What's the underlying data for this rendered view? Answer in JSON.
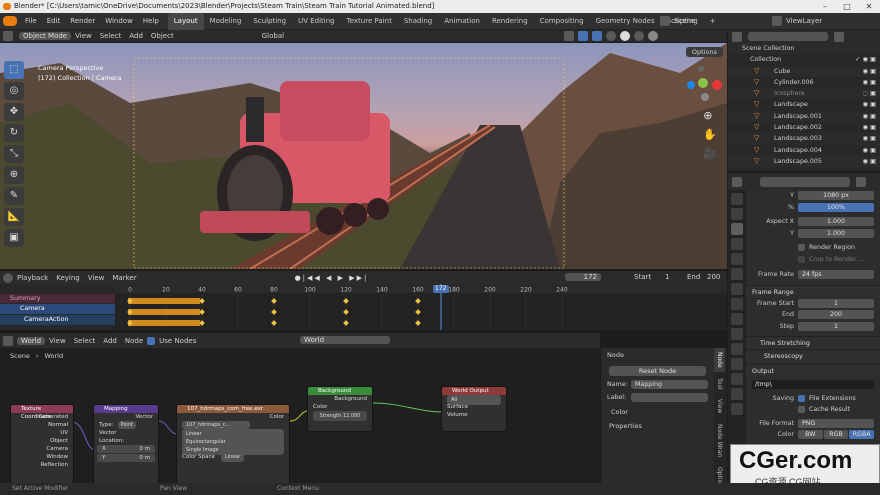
{
  "title_bar": {
    "title": "Blender* [C:\\Users\\tamic\\OneDrive\\Documents\\2023\\Blender\\Projects\\Steam Train\\Steam Train Tutorial Animated.blend]"
  },
  "top_menu": [
    "File",
    "Edit",
    "Render",
    "Window",
    "Help"
  ],
  "workspaces": [
    "Layout",
    "Modeling",
    "Sculpting",
    "UV Editing",
    "Texture Paint",
    "Shading",
    "Animation",
    "Rendering",
    "Compositing",
    "Geometry Nodes",
    "Scripting"
  ],
  "active_workspace": "Layout",
  "scene_name": "Scene",
  "view_layer": "ViewLayer",
  "viewport_header": {
    "mode": "Object Mode",
    "menus": [
      "View",
      "Select",
      "Add",
      "Object"
    ],
    "orientation": "Global",
    "options": "Options"
  },
  "viewport": {
    "overlay_line1": "Camera Perspective",
    "overlay_line2": "(172) Collection | Camera"
  },
  "timeline_header": {
    "menus": [
      "Playback",
      "Keying",
      "View",
      "Marker"
    ],
    "current_frame": "172",
    "start_label": "Start",
    "start": "1",
    "end_label": "End",
    "end": "200"
  },
  "timeline": {
    "tracks": [
      "Summary",
      "Camera",
      "CameraAction"
    ],
    "ticks": [
      "0",
      "20",
      "40",
      "60",
      "80",
      "100",
      "120",
      "140",
      "160",
      "180",
      "200",
      "220",
      "240"
    ],
    "playhead": "172"
  },
  "node_header": {
    "editor": "World",
    "menus": [
      "View",
      "Select",
      "Add",
      "Node"
    ],
    "use_nodes": "Use Nodes",
    "world_name": "World",
    "breadcrumb_scene": "Scene",
    "breadcrumb_world": "World"
  },
  "nodes": {
    "texcoord": {
      "title": "Texture Coordinate",
      "outputs": [
        "Generated",
        "Normal",
        "UV",
        "Object",
        "Camera",
        "Window",
        "Reflection"
      ]
    },
    "mapping": {
      "title": "Mapping",
      "out": "Vector",
      "type_label": "Type:",
      "type_value": "Point",
      "vector": "Vector",
      "location": "Location:",
      "x": "X",
      "x_val": "0 m",
      "y": "Y",
      "y_val": "0 m"
    },
    "image": {
      "title": "107_hdrmaps_com_free.exr",
      "out": "Color",
      "file": "107_hdrmaps_c...",
      "interp": "Linear",
      "proj": "Equirectangular",
      "ext": "Single Image",
      "colorspace_label": "Color Space",
      "colorspace": "Linear"
    },
    "background": {
      "title": "Background",
      "out": "Background",
      "color": "Color",
      "strength": "Strength 12.000"
    },
    "world_output": {
      "title": "World Output",
      "target": "All",
      "surface": "Surface",
      "volume": "Volume"
    }
  },
  "node_panel": {
    "section": "Node",
    "reset": "Reset Node",
    "name_label": "Name:",
    "name": "Mapping",
    "label_label": "Label:",
    "color": "Color",
    "properties": "Properties"
  },
  "node_tabs": [
    "Node",
    "Tool",
    "View",
    "Node Wran",
    "Optio"
  ],
  "outliner": {
    "root": "Scene Collection",
    "items": [
      "Collection",
      "Cube",
      "Cylinder.006",
      "Icosphere",
      "Landscape",
      "Landscape.001",
      "Landscape.002",
      "Landscape.003",
      "Landscape.004",
      "Landscape.005"
    ]
  },
  "properties": {
    "res_y": "1080 px",
    "res_pct": "100%",
    "aspect_x_label": "Aspect X",
    "aspect_x": "1.000",
    "aspect_y_label": "Y",
    "aspect_y": "1.000",
    "render_region": "Render Region",
    "crop": "Crop to Render ...",
    "frame_rate_label": "Frame Rate",
    "frame_rate": "24 fps",
    "frame_range": "Frame Range",
    "frame_start_label": "Frame Start",
    "frame_start": "1",
    "end_label": "End",
    "end": "200",
    "step_label": "Step",
    "step": "1",
    "time_stretching": "Time Stretching",
    "stereoscopy": "Stereoscopy",
    "output": "Output",
    "output_path": "/tmp\\",
    "saving_label": "Saving",
    "file_ext": "File Extensions",
    "cache": "Cache Result",
    "file_format_label": "File Format",
    "file_format": "PNG",
    "color_label": "Color",
    "bw": "BW",
    "rgb": "RGB",
    "rgba": "RGBA",
    "y_label": "Y",
    "pct_label": "%"
  },
  "statusbar": {
    "left": "Set Active Modifier",
    "mid": "Pan View",
    "right": "Context Menu"
  },
  "watermark": {
    "big": "CGer.com",
    "small": "CG资源 CG网站"
  }
}
